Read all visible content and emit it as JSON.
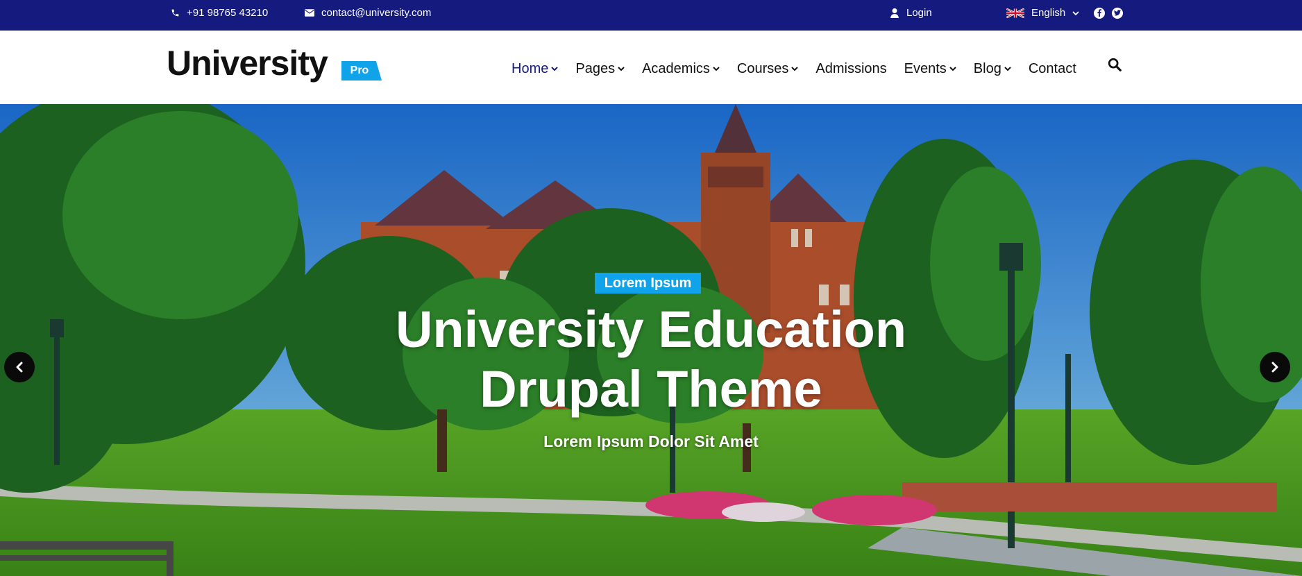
{
  "topbar": {
    "phone": "+91 98765 43210",
    "email": "contact@university.com",
    "login": "Login",
    "language": "English",
    "social": [
      "facebook-icon",
      "twitter-icon"
    ]
  },
  "header": {
    "logo": "University",
    "badge": "Pro",
    "nav": [
      {
        "label": "Home",
        "dropdown": true,
        "active": true
      },
      {
        "label": "Pages",
        "dropdown": true
      },
      {
        "label": "Academics",
        "dropdown": true
      },
      {
        "label": "Courses",
        "dropdown": true
      },
      {
        "label": "Admissions",
        "dropdown": false
      },
      {
        "label": "Events",
        "dropdown": true
      },
      {
        "label": "Blog",
        "dropdown": true
      },
      {
        "label": "Contact",
        "dropdown": false
      }
    ]
  },
  "hero": {
    "tag": "Lorem Ipsum",
    "title_line1": "University Education",
    "title_line2": "Drupal Theme",
    "subtitle": "Lorem Ipsum Dolor Sit Amet"
  },
  "colors": {
    "topbar_bg": "#151a7f",
    "accent": "#10a3ea",
    "active_nav": "#151a7f",
    "text": "#111111"
  }
}
